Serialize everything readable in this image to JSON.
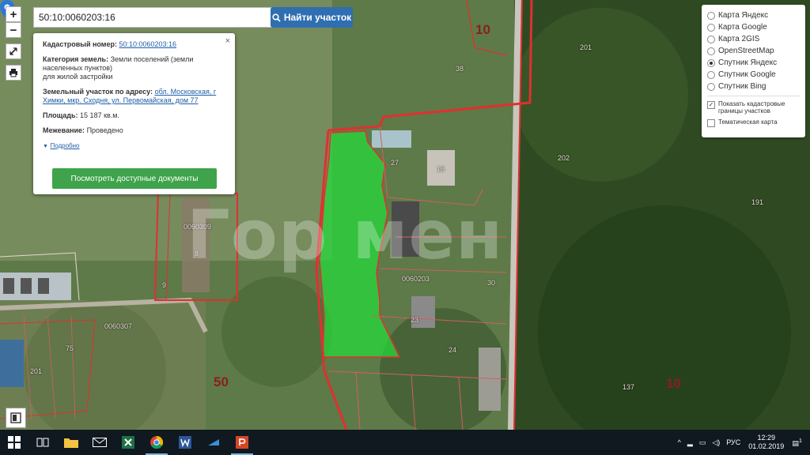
{
  "search": {
    "value": "50:10:0060203:16",
    "button_label": "Найти участок"
  },
  "toolbar": {
    "zoom_in": "+",
    "zoom_out": "−"
  },
  "popup": {
    "close": "×",
    "cadastral_label": "Кадастровый номер:",
    "cadastral_value": "50:10:0060203:16",
    "category_label": "Категория земель:",
    "category_value": "Земли поселений (земли населенных пунктов)",
    "purpose_value": "для жилой застройки",
    "address_label": "Земельный участок по адресу:",
    "address_value": "обл. Московская, г Химки, мкр. Сходня, ул. Первомайская, дом 77",
    "area_label": "Площадь:",
    "area_value": "15 187 кв.м.",
    "survey_label": "Межевание:",
    "survey_value": "Проведено",
    "more_label": "Подробно",
    "docs_button": "Посмотреть доступные документы"
  },
  "layers": {
    "options": [
      {
        "label": "Карта Яндекс",
        "selected": false
      },
      {
        "label": "Карта Google",
        "selected": false
      },
      {
        "label": "Карта 2GIS",
        "selected": false
      },
      {
        "label": "OpenStreetMap",
        "selected": false
      },
      {
        "label": "Спутник Яндекс",
        "selected": true
      },
      {
        "label": "Спутник Google",
        "selected": false
      },
      {
        "label": "Спутник Bing",
        "selected": false
      }
    ],
    "show_borders_label": "Показать кадастровые границы участков",
    "thematic_label": "Тематическая карта"
  },
  "map_labels": {
    "watermark": "Гор   мен",
    "quarter_top": "10",
    "quarter_bottom_left": "50",
    "quarter_bottom_right": "10",
    "block_left": "0060309",
    "block_center": "0060203",
    "block_bottom": "0060307",
    "plot_numbers": [
      "38",
      "201",
      "202",
      "191",
      "137",
      "27",
      "16",
      "30",
      "23",
      "24",
      "201",
      "8",
      "9",
      "75"
    ]
  },
  "taskbar": {
    "language": "РУС",
    "time": "12:29",
    "date": "01.02.2019",
    "notification_count": "1"
  },
  "colors": {
    "parcel_fill": "#22dd3a",
    "boundary": "#e03030",
    "search_button": "#2f6fb1",
    "docs_button": "#3ea34a"
  }
}
